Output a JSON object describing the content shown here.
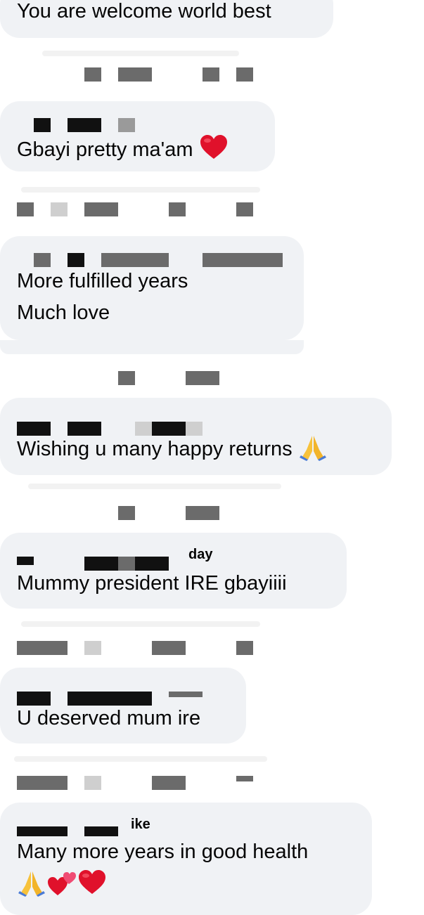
{
  "comments": [
    {
      "text": "You are welcome world best"
    },
    {
      "text": "Gbayi pretty ma'am"
    },
    {
      "line1": "More fulfilled years",
      "line2": "Much love"
    },
    {
      "text": "Wishing u many happy returns"
    },
    {
      "text": "Mummy president IRE gbayiiii"
    },
    {
      "text": "U deserved mum ire"
    },
    {
      "line1": "Many more years in good health"
    }
  ],
  "fragments": {
    "day": "day",
    "ike": "ike"
  },
  "icons": {
    "heart": "red-heart-icon",
    "pray": "folded-hands-icon",
    "two_hearts": "two-hearts-icon"
  },
  "colors": {
    "bubble": "#f0f2f5",
    "heart": "#e0112b",
    "pray": "#f7c23b"
  }
}
